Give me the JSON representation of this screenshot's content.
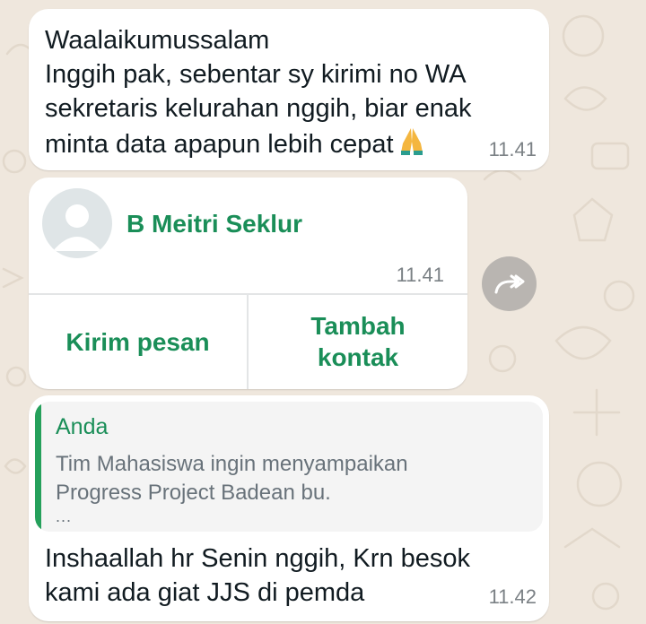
{
  "messages": {
    "first": {
      "lines": [
        "Waalaikumussalam",
        "Inggih pak, sebentar sy kirimi no WA",
        "sekretaris kelurahan nggih, biar enak",
        "minta data apapun lebih cepat"
      ],
      "emoji": "folded-hands",
      "time": "11.41"
    },
    "contact_card": {
      "name": "B Meitri Seklur",
      "time": "11.41",
      "send_label": "Kirim pesan",
      "add_label_line1": "Tambah",
      "add_label_line2": "kontak"
    },
    "reply": {
      "quote_author": "Anda",
      "quote_lines": [
        "Tim Mahasiswa ingin menyampaikan",
        "Progress Project Badean bu."
      ],
      "quote_more": "...",
      "lines": [
        "Inshaallah hr Senin nggih, Krn besok",
        "kami ada giat JJS di pemda"
      ],
      "time": "11.42"
    }
  },
  "colors": {
    "background": "#efe7dd",
    "accent_green": "#1a8e58",
    "bubble": "#ffffff"
  },
  "icons": [
    "folded-hands-emoji",
    "default-avatar-icon",
    "forward-icon"
  ]
}
